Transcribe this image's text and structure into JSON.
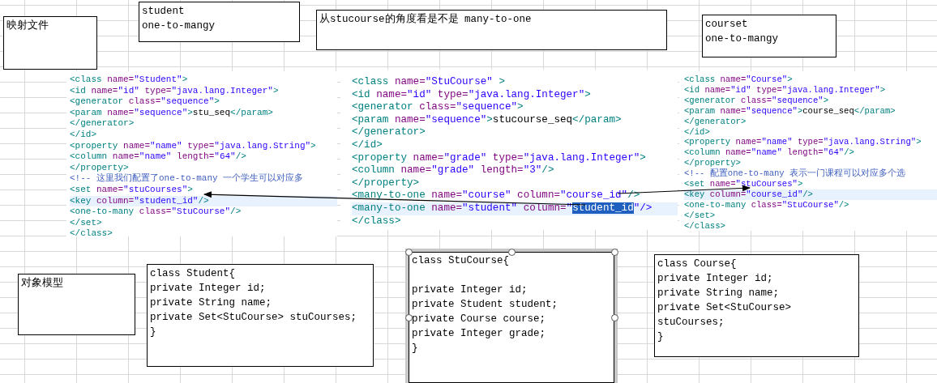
{
  "text_boxes": [
    {
      "paragraphs": [
        [
          "映射文件"
        ]
      ],
      "selected": false
    },
    {
      "paragraphs": [
        [
          "student",
          "one-to-mangy"
        ]
      ],
      "selected": false
    },
    {
      "paragraphs": [
        [
          "从stucourse的角度看是不是 many-to-one"
        ]
      ],
      "selected": false
    },
    {
      "paragraphs": [
        [
          "courset",
          "one-to-mangy"
        ]
      ],
      "selected": false
    },
    {
      "paragraphs": [
        [
          "对象模型"
        ]
      ],
      "selected": false
    },
    {
      "paragraphs": [
        [
          "class Student{",
          "private Integer id;",
          "private String name;",
          "private Set<StuCourse> stuCourses;",
          "}"
        ]
      ],
      "selected": false
    },
    {
      "paragraphs": [
        [
          "class StuCourse{"
        ],
        [
          "private Integer id;",
          "private Student student;",
          "private Course course;",
          "private Integer grade;",
          "}"
        ]
      ],
      "selected": true
    },
    {
      "paragraphs": [
        [
          "class Course{",
          "private Integer id;",
          "private String name;",
          "private Set<StuCourse>",
          "stuCourses;",
          "}"
        ]
      ],
      "selected": false
    }
  ],
  "code_panels": [
    {
      "lines": [
        {
          "highlighted": false,
          "segments": [
            {
              "text": "<class name=\"Student\">",
              "selected": false
            }
          ]
        },
        {
          "highlighted": false,
          "segments": [
            {
              "text": "<id name=\"id\" type=\"java.lang.Integer\">",
              "selected": false
            }
          ]
        },
        {
          "highlighted": false,
          "segments": [
            {
              "text": "<generator class=\"sequence\">",
              "selected": false
            }
          ]
        },
        {
          "highlighted": false,
          "segments": [
            {
              "text": "<param name=\"sequence\">stu_seq</param>",
              "selected": false
            }
          ]
        },
        {
          "highlighted": false,
          "segments": [
            {
              "text": "</generator>",
              "selected": false
            }
          ]
        },
        {
          "highlighted": false,
          "segments": [
            {
              "text": "</id>",
              "selected": false
            }
          ]
        },
        {
          "highlighted": false,
          "segments": [
            {
              "text": "<property name=\"name\" type=\"java.lang.String\">",
              "selected": false
            }
          ]
        },
        {
          "highlighted": false,
          "segments": [
            {
              "text": "<column name=\"name\" length=\"64\"/>",
              "selected": false
            }
          ]
        },
        {
          "highlighted": false,
          "segments": [
            {
              "text": "</property>",
              "selected": false
            }
          ]
        },
        {
          "highlighted": false,
          "segments": [
            {
              "text": "<!-- 这里我们配置了one-to-many 一个学生可以对应多",
              "selected": false
            }
          ]
        },
        {
          "highlighted": false,
          "segments": [
            {
              "text": "<set name=\"stuCourses\">",
              "selected": false
            }
          ]
        },
        {
          "highlighted": true,
          "segments": [
            {
              "text": "<key column=\"student_id\"/>",
              "selected": false
            }
          ]
        },
        {
          "highlighted": false,
          "segments": [
            {
              "text": "<one-to-many class=\"StuCourse\"/>",
              "selected": false
            }
          ]
        },
        {
          "highlighted": false,
          "segments": [
            {
              "text": "</set>",
              "selected": false
            }
          ]
        },
        {
          "highlighted": false,
          "segments": [
            {
              "text": "</class>",
              "selected": false
            }
          ]
        }
      ]
    },
    {
      "lines": [
        {
          "highlighted": false,
          "segments": [
            {
              "text": "<class name=\"StuCourse\" >",
              "selected": false
            }
          ]
        },
        {
          "highlighted": false,
          "segments": [
            {
              "text": "<id name=\"id\" type=\"java.lang.Integer\">",
              "selected": false
            }
          ]
        },
        {
          "highlighted": false,
          "segments": [
            {
              "text": "<generator class=\"sequence\">",
              "selected": false
            }
          ]
        },
        {
          "highlighted": false,
          "segments": [
            {
              "text": "<param name=\"sequence\">stucourse_seq</param>",
              "selected": false
            }
          ]
        },
        {
          "highlighted": false,
          "segments": [
            {
              "text": "</generator>",
              "selected": false
            }
          ]
        },
        {
          "highlighted": false,
          "segments": [
            {
              "text": "</id>",
              "selected": false
            }
          ]
        },
        {
          "highlighted": false,
          "segments": [
            {
              "text": "<property name=\"grade\" type=\"java.lang.Integer\">",
              "selected": false
            }
          ]
        },
        {
          "highlighted": false,
          "segments": [
            {
              "text": "<column name=\"grade\" length=\"3\"/>",
              "selected": false
            }
          ]
        },
        {
          "highlighted": false,
          "segments": [
            {
              "text": "</property>",
              "selected": false
            }
          ]
        },
        {
          "highlighted": false,
          "segments": [
            {
              "text": "<many-to-one name=\"course\" column=\"course_id\"/>",
              "selected": false
            }
          ]
        },
        {
          "highlighted": true,
          "segments": [
            {
              "text": "<many-to-one name=\"student\" column=\"",
              "selected": false
            },
            {
              "text": "student_id",
              "selected": true
            },
            {
              "text": "\"/>",
              "selected": false
            }
          ]
        },
        {
          "highlighted": false,
          "segments": [
            {
              "text": "</class>",
              "selected": false
            }
          ]
        }
      ]
    },
    {
      "lines": [
        {
          "highlighted": false,
          "segments": [
            {
              "text": "<class name=\"Course\">",
              "selected": false
            }
          ]
        },
        {
          "highlighted": false,
          "segments": [
            {
              "text": "<id name=\"id\" type=\"java.lang.Integer\">",
              "selected": false
            }
          ]
        },
        {
          "highlighted": false,
          "segments": [
            {
              "text": "<generator class=\"sequence\">",
              "selected": false
            }
          ]
        },
        {
          "highlighted": false,
          "segments": [
            {
              "text": "<param name=\"sequence\">course_seq</param>",
              "selected": false
            }
          ]
        },
        {
          "highlighted": false,
          "segments": [
            {
              "text": "</generator>",
              "selected": false
            }
          ]
        },
        {
          "highlighted": false,
          "segments": [
            {
              "text": "</id>",
              "selected": false
            }
          ]
        },
        {
          "highlighted": false,
          "segments": [
            {
              "text": "<property name=\"name\" type=\"java.lang.String\">",
              "selected": false
            }
          ]
        },
        {
          "highlighted": false,
          "segments": [
            {
              "text": "<column name=\"name\" length=\"64\"/>",
              "selected": false
            }
          ]
        },
        {
          "highlighted": false,
          "segments": [
            {
              "text": "</property>",
              "selected": false
            }
          ]
        },
        {
          "highlighted": false,
          "segments": [
            {
              "text": "<!-- 配置one-to-many 表示一门课程可以对应多个选",
              "selected": false
            }
          ]
        },
        {
          "highlighted": false,
          "segments": [
            {
              "text": "<set name=\"stuCourses\">",
              "selected": false
            }
          ]
        },
        {
          "highlighted": true,
          "segments": [
            {
              "text": "<key column=\"course_id\"/>",
              "selected": false
            }
          ]
        },
        {
          "highlighted": false,
          "segments": [
            {
              "text": "<one-to-many class=\"StuCourse\"/>",
              "selected": false
            }
          ]
        },
        {
          "highlighted": false,
          "segments": [
            {
              "text": "</set>",
              "selected": false
            }
          ]
        },
        {
          "highlighted": false,
          "segments": [
            {
              "text": "</class>",
              "selected": false
            }
          ]
        }
      ]
    }
  ]
}
